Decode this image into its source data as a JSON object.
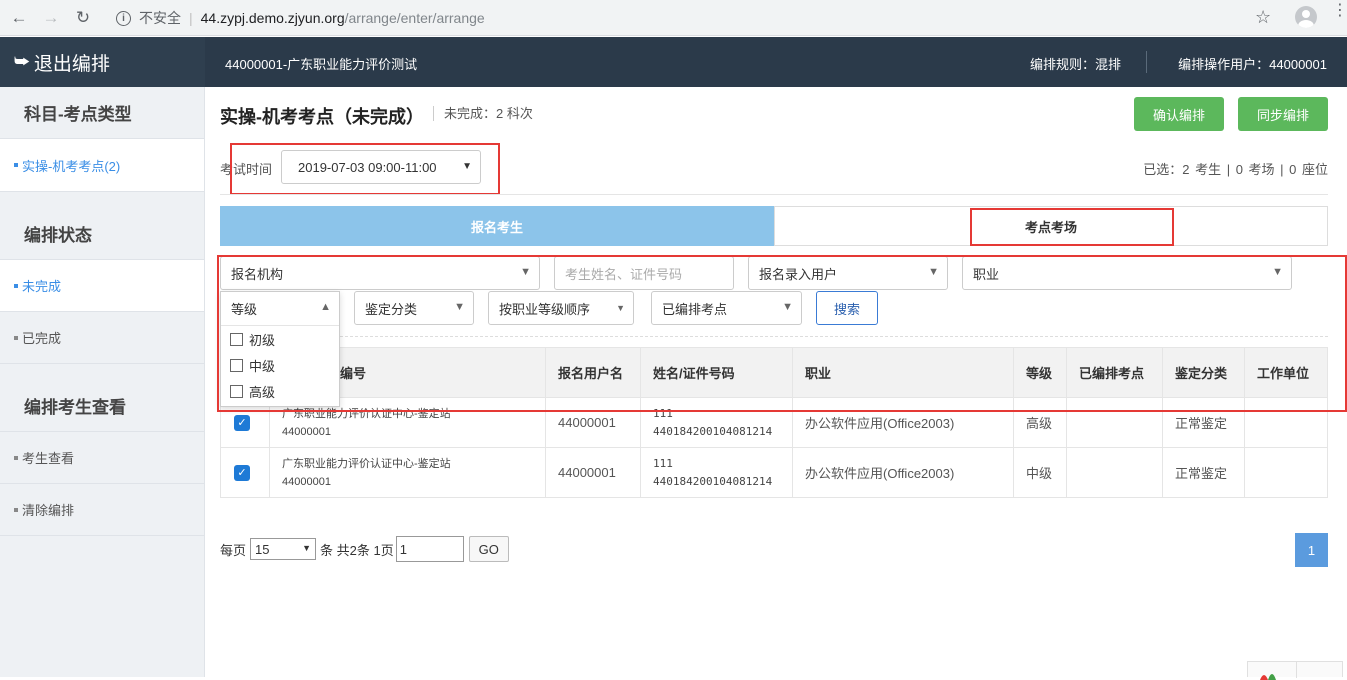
{
  "browser": {
    "insecure_label": "不安全",
    "url_host": "44.zypj.demo.zjyun.org",
    "url_path": "/arrange/enter/arrange"
  },
  "header": {
    "exit_label": "退出编排",
    "exam_title": "44000001-广东职业能力评价测试",
    "rule": "编排规则：混排",
    "operator": "编排操作用户：44000001"
  },
  "sidebar": {
    "section_subject": "科目-考点类型",
    "subject_item": "实操-机考考点(2)",
    "section_status": "编排状态",
    "status_incomplete": "未完成",
    "status_complete": "已完成",
    "section_view": "编排考生查看",
    "view_students": "考生查看",
    "clear_arrange": "清除编排"
  },
  "main": {
    "title": "实操-机考考点（未完成）",
    "subtitle": "未完成：2 科次",
    "confirm_button": "确认编排",
    "sync_button": "同步编排",
    "exam_time_label": "考试时间",
    "exam_time_value": "2019-07-03 09:00-11:00",
    "selection_summary": "已选：2 考生  |  0 考场  |  0 座位",
    "tab_students": "报名考生",
    "tab_sites": "考点考场"
  },
  "filters": {
    "org": "报名机构",
    "name_placeholder": "考生姓名、证件号码",
    "entry_user": "报名录入用户",
    "occupation": "职业",
    "level": "等级",
    "level_options": [
      "初级",
      "中级",
      "高级"
    ],
    "appraisal": "鉴定分类",
    "order": "按职业等级顺序",
    "arranged": "已编排考点",
    "search_button": "搜索"
  },
  "table": {
    "headers": [
      "",
      "报名机构/编号",
      "报名用户名",
      "姓名/证件号码",
      "职业",
      "等级",
      "已编排考点",
      "鉴定分类",
      "工作单位"
    ],
    "header_org_visible": "编号",
    "rows": [
      {
        "org_name": "广东职业能力评价认证中心-鉴定站",
        "org_code": "44000001",
        "username": "44000001",
        "name": "111",
        "id_number": "440184200104081214",
        "occupation": "办公软件应用(Office2003)",
        "level": "高级",
        "arranged_site": "",
        "appraisal": "正常鉴定",
        "employer": ""
      },
      {
        "org_name": "广东职业能力评价认证中心-鉴定站",
        "org_code": "44000001",
        "username": "44000001",
        "name": "111",
        "id_number": "440184200104081214",
        "occupation": "办公软件应用(Office2003)",
        "level": "中级",
        "arranged_site": "",
        "appraisal": "正常鉴定",
        "employer": ""
      }
    ]
  },
  "pager": {
    "per_page_label": "每页",
    "page_size": "15",
    "summary": "条 共2条 1页",
    "page_input": "1",
    "go_label": "GO",
    "current_page": "1"
  },
  "colors": {
    "accent_green": "#5cb85c",
    "tab_active": "#8cc4ea",
    "highlight_red": "#e53935",
    "header_dark": "#2b3a4a"
  }
}
